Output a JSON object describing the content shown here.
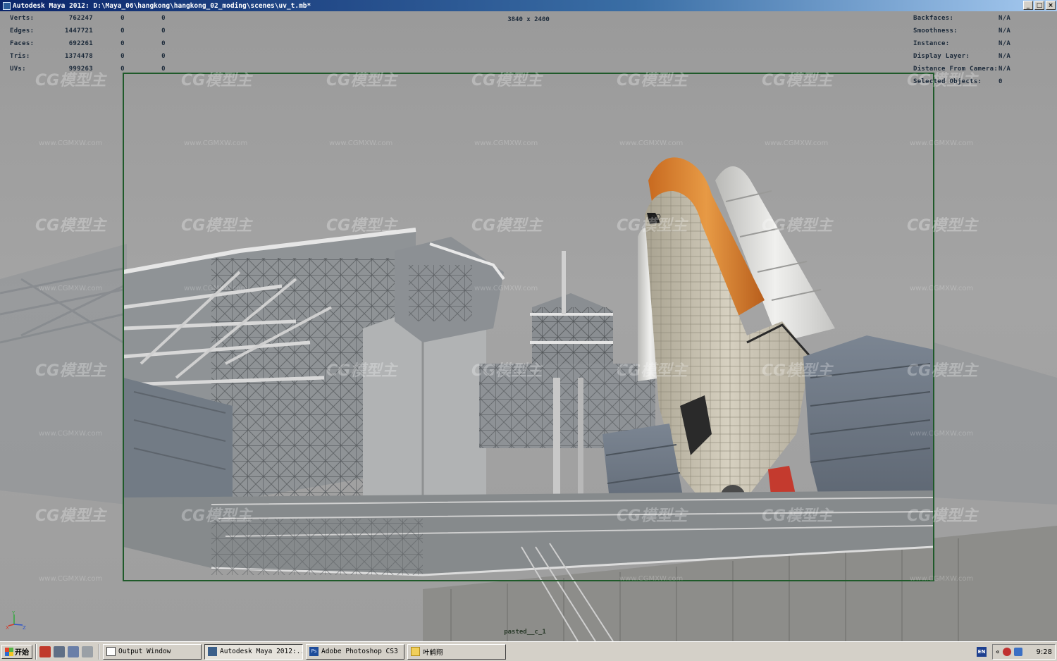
{
  "window": {
    "title": "Autodesk Maya 2012: D:\\Maya_06\\hangkong\\hangkong_02_moding\\scenes\\uv_t.mb*",
    "buttons": [
      "_",
      "□",
      "×"
    ]
  },
  "hud_left": [
    {
      "label": "Verts:",
      "v1": "762247",
      "v2": "0",
      "v3": "0"
    },
    {
      "label": "Edges:",
      "v1": "1447721",
      "v2": "0",
      "v3": "0"
    },
    {
      "label": "Faces:",
      "v1": "692261",
      "v2": "0",
      "v3": "0"
    },
    {
      "label": "Tris:",
      "v1": "1374478",
      "v2": "0",
      "v3": "0"
    },
    {
      "label": "UVs:",
      "v1": "999263",
      "v2": "0",
      "v3": "0"
    }
  ],
  "hud_right": [
    {
      "label": "Backfaces:",
      "value": "N/A"
    },
    {
      "label": "Smoothness:",
      "value": "N/A"
    },
    {
      "label": "Instance:",
      "value": "N/A"
    },
    {
      "label": "Display Layer:",
      "value": "N/A"
    },
    {
      "label": "Distance From Camera:",
      "value": "N/A"
    },
    {
      "label": "Selected Objects:",
      "value": "0"
    }
  ],
  "viewport": {
    "resolution": "3840 x 2400",
    "camera_name": "pasted__c_1",
    "gate_color": "#1f5a2a",
    "axis": {
      "x": "X",
      "y": "Y",
      "z": "Z"
    }
  },
  "watermark": {
    "logo_text": "CG模型主",
    "url_text": "www.CGMXW.com"
  },
  "taskbar": {
    "start_label": "开始",
    "tasks": [
      {
        "label": "Output Window",
        "icon": "output-window-icon",
        "active": false
      },
      {
        "label": "Autodesk Maya 2012:...",
        "icon": "maya-icon",
        "active": true
      },
      {
        "label": "Adobe Photoshop CS3",
        "icon": "photoshop-icon",
        "active": false
      },
      {
        "label": "叶鹤翔",
        "icon": "folder-icon",
        "active": false
      }
    ],
    "language": "EN",
    "clock": "9:28",
    "tray_toggle": "«"
  }
}
